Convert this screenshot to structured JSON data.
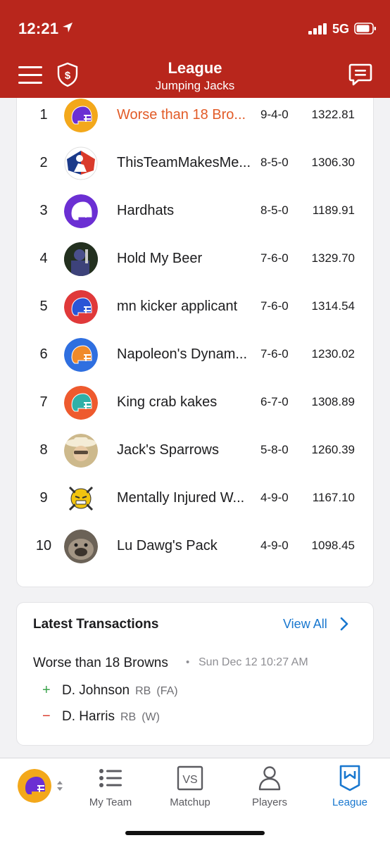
{
  "status_bar": {
    "time": "12:21",
    "network": "5G"
  },
  "header": {
    "title": "League",
    "subtitle": "Jumping Jacks"
  },
  "standings": [
    {
      "rank": "1",
      "team": "Worse than 18 Bro...",
      "record": "9-4-0",
      "points": "1322.81",
      "avatar": "purple-helmet",
      "color": "#f3a81b",
      "helmet": "#6b2fd3",
      "mine": true
    },
    {
      "rank": "2",
      "team": "ThisTeamMakesMe...",
      "record": "8-5-0",
      "points": "1306.30",
      "avatar": "mlb-logo",
      "color": "#ffffff",
      "helmet": "#d93a2b"
    },
    {
      "rank": "3",
      "team": "Hardhats",
      "record": "8-5-0",
      "points": "1189.91",
      "avatar": "white-helmet",
      "color": "#6b2fd3",
      "helmet": "#ffffff"
    },
    {
      "rank": "4",
      "team": "Hold My Beer",
      "record": "7-6-0",
      "points": "1329.70",
      "avatar": "photo",
      "color": "#2a3a2a",
      "helmet": "#4a4f8c"
    },
    {
      "rank": "5",
      "team": "mn kicker applicant",
      "record": "7-6-0",
      "points": "1314.54",
      "avatar": "blue-helmet",
      "color": "#e0393a",
      "helmet": "#2a55d6"
    },
    {
      "rank": "6",
      "team": "Napoleon's Dynam...",
      "record": "7-6-0",
      "points": "1230.02",
      "avatar": "orange-helmet",
      "color": "#2f6fe0",
      "helmet": "#f08a2a"
    },
    {
      "rank": "7",
      "team": "King crab kakes",
      "record": "6-7-0",
      "points": "1308.89",
      "avatar": "teal-helmet",
      "color": "#ee5a2e",
      "helmet": "#2fb0a8"
    },
    {
      "rank": "8",
      "team": "Jack's Sparrows",
      "record": "5-8-0",
      "points": "1260.39",
      "avatar": "cowboy-photo",
      "color": "#cdb98c",
      "helmet": "#e8d7a6"
    },
    {
      "rank": "9",
      "team": "Mentally Injured W...",
      "record": "4-9-0",
      "points": "1167.10",
      "avatar": "skull-emoji",
      "color": "#ffffff",
      "helmet": "#f1c40f"
    },
    {
      "rank": "10",
      "team": "Lu Dawg's Pack",
      "record": "4-9-0",
      "points": "1098.45",
      "avatar": "dog-photo",
      "color": "#6b6257",
      "helmet": "#8a7e6f"
    }
  ],
  "transactions": {
    "title": "Latest Transactions",
    "view_all": "View All",
    "items": [
      {
        "team": "Worse than 18 Browns",
        "separator": "•",
        "date": "Sun Dec 12 10:27 AM",
        "moves": [
          {
            "sign": "+",
            "player": "D. Johnson",
            "position": "RB",
            "source": "(FA)"
          },
          {
            "sign": "−",
            "player": "D. Harris",
            "position": "RB",
            "source": "(W)"
          }
        ]
      }
    ]
  },
  "tabs": {
    "my_team": "My Team",
    "matchup": "Matchup",
    "players": "Players",
    "league": "League",
    "matchup_icon_text": "VS"
  },
  "colors": {
    "header_red": "#b8261c",
    "accent_orange": "#e25b27",
    "link_blue": "#1877cf"
  }
}
